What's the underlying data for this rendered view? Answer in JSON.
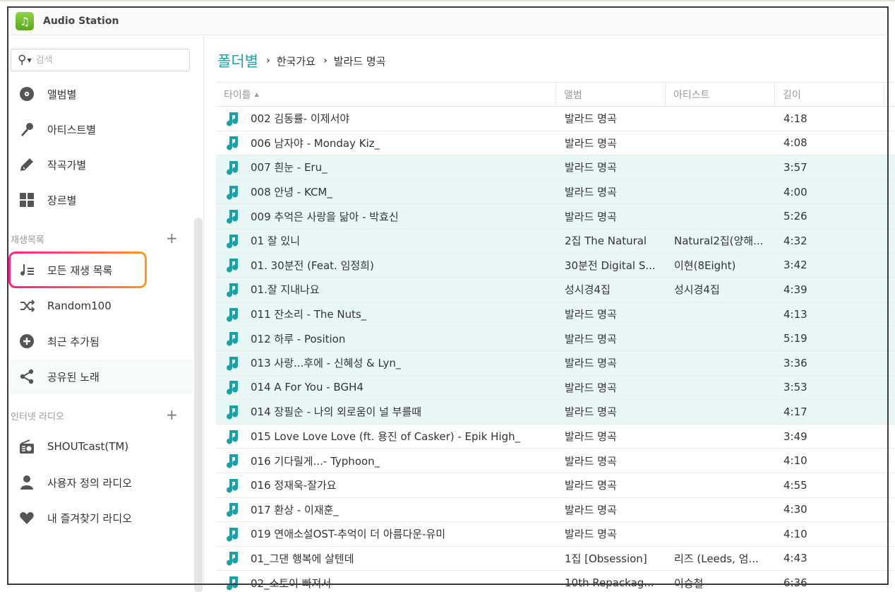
{
  "app": {
    "title": "Audio Station"
  },
  "search": {
    "placeholder": "검색"
  },
  "library": {
    "items": [
      {
        "label": "앨범별",
        "icon": "disc-icon"
      },
      {
        "label": "아티스트별",
        "icon": "microphone-icon"
      },
      {
        "label": "작곡가별",
        "icon": "pen-icon"
      },
      {
        "label": "장르별",
        "icon": "grid-icon"
      }
    ]
  },
  "playlists": {
    "header": "재생목록",
    "items": [
      {
        "label": "모든 재생 목록",
        "icon": "playlist-icon"
      },
      {
        "label": "Random100",
        "icon": "shuffle-icon"
      },
      {
        "label": "최근 추가됨",
        "icon": "plus-circle-icon"
      },
      {
        "label": "공유된 노래",
        "icon": "share-icon"
      }
    ]
  },
  "radio": {
    "header": "인터넷 라디오",
    "items": [
      {
        "label": "SHOUTcast(TM)",
        "icon": "radio-icon"
      },
      {
        "label": "사용자 정의 라디오",
        "icon": "user-icon"
      },
      {
        "label": "내 즐겨찾기 라디오",
        "icon": "heart-icon"
      }
    ]
  },
  "breadcrumb": {
    "root": "폴더별",
    "items": [
      "한국가요",
      "발라드 명곡"
    ]
  },
  "table": {
    "columns": {
      "title": "타이틀",
      "album": "앨범",
      "artist": "아티스트",
      "length": "길이"
    },
    "sort_indicator": "▲",
    "rows": [
      {
        "title": "002 김동률- 이제서야",
        "album": "발라드 명곡",
        "artist": "",
        "length": "4:18",
        "selected": false
      },
      {
        "title": "006 남자야 - Monday Kiz_",
        "album": "발라드 명곡",
        "artist": "",
        "length": "4:08",
        "selected": false
      },
      {
        "title": "007 흰눈 - Eru_",
        "album": "발라드 명곡",
        "artist": "",
        "length": "3:57",
        "selected": true
      },
      {
        "title": "008 안녕 - KCM_",
        "album": "발라드 명곡",
        "artist": "",
        "length": "4:00",
        "selected": true
      },
      {
        "title": "009 추억은 사랑을 닮아 - 박효신",
        "album": "발라드 명곡",
        "artist": "",
        "length": "5:26",
        "selected": true
      },
      {
        "title": "01 잘 있니",
        "album": "2집 The Natural",
        "artist": "Natural2집(양해...",
        "length": "4:32",
        "selected": true
      },
      {
        "title": "01. 30분전 (Feat. 임정희)",
        "album": "30분전 Digital S...",
        "artist": "이현(8Eight)",
        "length": "3:42",
        "selected": true
      },
      {
        "title": "01.잘 지내나요",
        "album": "성시경4집",
        "artist": "성시경4집",
        "length": "4:39",
        "selected": true
      },
      {
        "title": "011 잔소리 - The Nuts_",
        "album": "발라드 명곡",
        "artist": "",
        "length": "4:13",
        "selected": true
      },
      {
        "title": "012 하루 - Position",
        "album": "발라드 명곡",
        "artist": "",
        "length": "5:19",
        "selected": true
      },
      {
        "title": "013 사랑...후에 - 신혜성 & Lyn_",
        "album": "발라드 명곡",
        "artist": "",
        "length": "3:36",
        "selected": true
      },
      {
        "title": "014 A For You - BGH4",
        "album": "발라드 명곡",
        "artist": "",
        "length": "3:53",
        "selected": true
      },
      {
        "title": "014 장필순 - 나의 외로움이 널 부를때",
        "album": "발라드 명곡",
        "artist": "",
        "length": "4:17",
        "selected": true
      },
      {
        "title": "015 Love Love Love (ft. 용진 of Casker) - Epik High_",
        "album": "발라드 명곡",
        "artist": "",
        "length": "3:49",
        "selected": false
      },
      {
        "title": "016 기다릴게...- Typhoon_",
        "album": "발라드 명곡",
        "artist": "",
        "length": "4:10",
        "selected": false
      },
      {
        "title": "016 정재욱-잘가요",
        "album": "발라드 명곡",
        "artist": "",
        "length": "4:55",
        "selected": false
      },
      {
        "title": "017 환상 - 이재훈_",
        "album": "발라드 명곡",
        "artist": "",
        "length": "4:30",
        "selected": false
      },
      {
        "title": "019 연애소설OST-추억이 더 아름다운-유미",
        "album": "발라드 명곡",
        "artist": "",
        "length": "4:10",
        "selected": false
      },
      {
        "title": "01_그댄 행복에 살텐데",
        "album": "1집 [Obsession]",
        "artist": "리즈 (Leeds, 엄...",
        "length": "4:43",
        "selected": false
      },
      {
        "title": "02_소토이 빠져서",
        "album": "10th Repackag...",
        "artist": "이승철",
        "length": "6:36",
        "selected": false
      }
    ]
  },
  "colors": {
    "accent": "#1da3a5",
    "selection": "#e8f7f5",
    "highlight_gradient": [
      "#ff1f8a",
      "#ff9a1a"
    ]
  }
}
